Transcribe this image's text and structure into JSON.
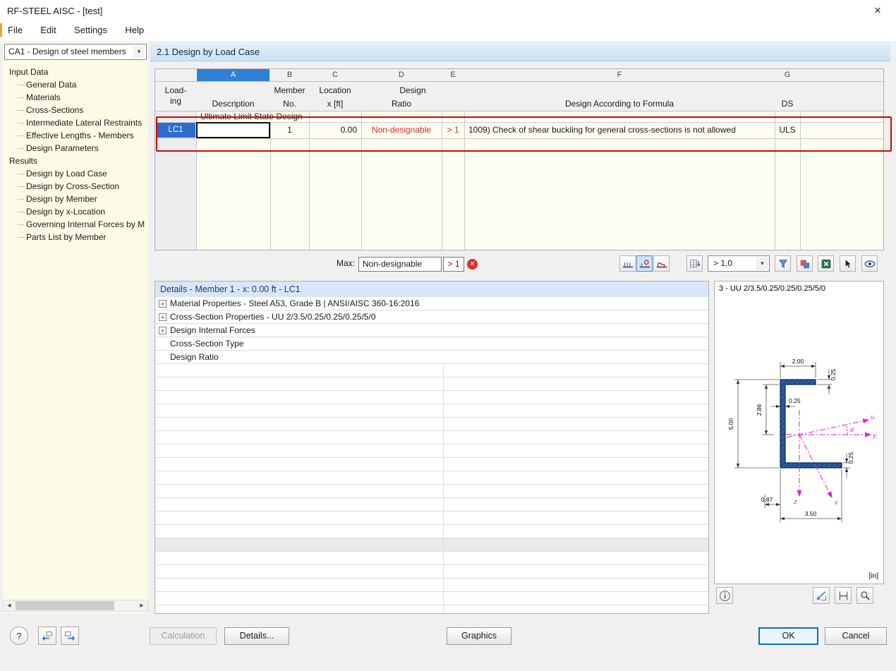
{
  "window": {
    "title": "RF-STEEL AISC - [test]"
  },
  "icons": {
    "close": "×",
    "chevron": "▾",
    "expand": "+",
    "help": "?",
    "info": "i",
    "scroll_left": "◀",
    "scroll_right": "▶",
    "error": "×"
  },
  "menu": {
    "items": [
      "File",
      "Edit",
      "Settings",
      "Help"
    ]
  },
  "nav": {
    "case_selector": "CA1 - Design of steel members",
    "tree": [
      {
        "label": "Input Data",
        "level": 0
      },
      {
        "label": "General Data",
        "level": 1
      },
      {
        "label": "Materials",
        "level": 1
      },
      {
        "label": "Cross-Sections",
        "level": 1
      },
      {
        "label": "Intermediate Lateral Restraints",
        "level": 1
      },
      {
        "label": "Effective Lengths - Members",
        "level": 1
      },
      {
        "label": "Design Parameters",
        "level": 1
      },
      {
        "label": "Results",
        "level": 0
      },
      {
        "label": "Design by Load Case",
        "level": 1
      },
      {
        "label": "Design by Cross-Section",
        "level": 1
      },
      {
        "label": "Design by Member",
        "level": 1
      },
      {
        "label": "Design by x-Location",
        "level": 1
      },
      {
        "label": "Governing Internal Forces by M",
        "level": 1
      },
      {
        "label": "Parts List by Member",
        "level": 1
      }
    ]
  },
  "main": {
    "section_title": "2.1 Design by Load Case",
    "table": {
      "letters": [
        "A",
        "B",
        "C",
        "D",
        "E",
        "F",
        "G"
      ],
      "headers": {
        "loading_1": "Load-",
        "loading_2": "ing",
        "description": "Description",
        "member_1": "Member",
        "member_2": "No.",
        "location_1": "Location",
        "location_2": "x [ft]",
        "design_1": "Design",
        "design_2": "Ratio",
        "formula": "Design According to Formula",
        "ds": "DS"
      },
      "group_label": "Ultimate Limit State Design",
      "row": {
        "loading": "LC1",
        "description": "",
        "member_no": "1",
        "location": "0.00",
        "ratio": "Non-designable",
        "ratio_flag": "> 1",
        "formula": "1009) Check of shear buckling for general cross-sections is not allowed",
        "ds": "ULS"
      }
    },
    "maxbar": {
      "label": "Max:",
      "value": "Non-designable",
      "flag": "> 1",
      "filter": "> 1,0"
    }
  },
  "details": {
    "title": "Details - Member 1 - x: 0.00 ft - LC1",
    "rows": [
      {
        "label": "Material Properties - Steel A53, Grade B | ANSI/AISC 360-16:2016"
      },
      {
        "label": "Cross-Section Properties - UU 2/3.5/0.25/0.25/0.25/5/0"
      },
      {
        "label": "Design Internal Forces"
      },
      {
        "label": "Cross-Section Type"
      },
      {
        "label": "Design Ratio"
      }
    ]
  },
  "section_view": {
    "title": "3 - UU 2/3.5/0.25/0.25/0.25/5/0",
    "unit": "[in]",
    "dims": {
      "top_width": "2.00",
      "top_thickness": "0.25",
      "web_thickness": "0.25",
      "upper_height": "2.86",
      "total_height": "5.00",
      "bottom_thickness": "0.25",
      "bottom_offset": "0.87",
      "bottom_width": "3.50"
    },
    "axes": {
      "u": "u",
      "v": "v",
      "y": "y",
      "z": "z",
      "alpha": "α"
    }
  },
  "footer": {
    "calculation": "Calculation",
    "details": "Details...",
    "graphics": "Graphics",
    "ok": "OK",
    "cancel": "Cancel"
  },
  "colors": {
    "selection_blue": "#2f7fd6",
    "row_blue": "#2d6bcc",
    "error_red": "#d22d2d",
    "annotation_red": "#c20d0d",
    "header_blue": "#d7e7f7"
  }
}
